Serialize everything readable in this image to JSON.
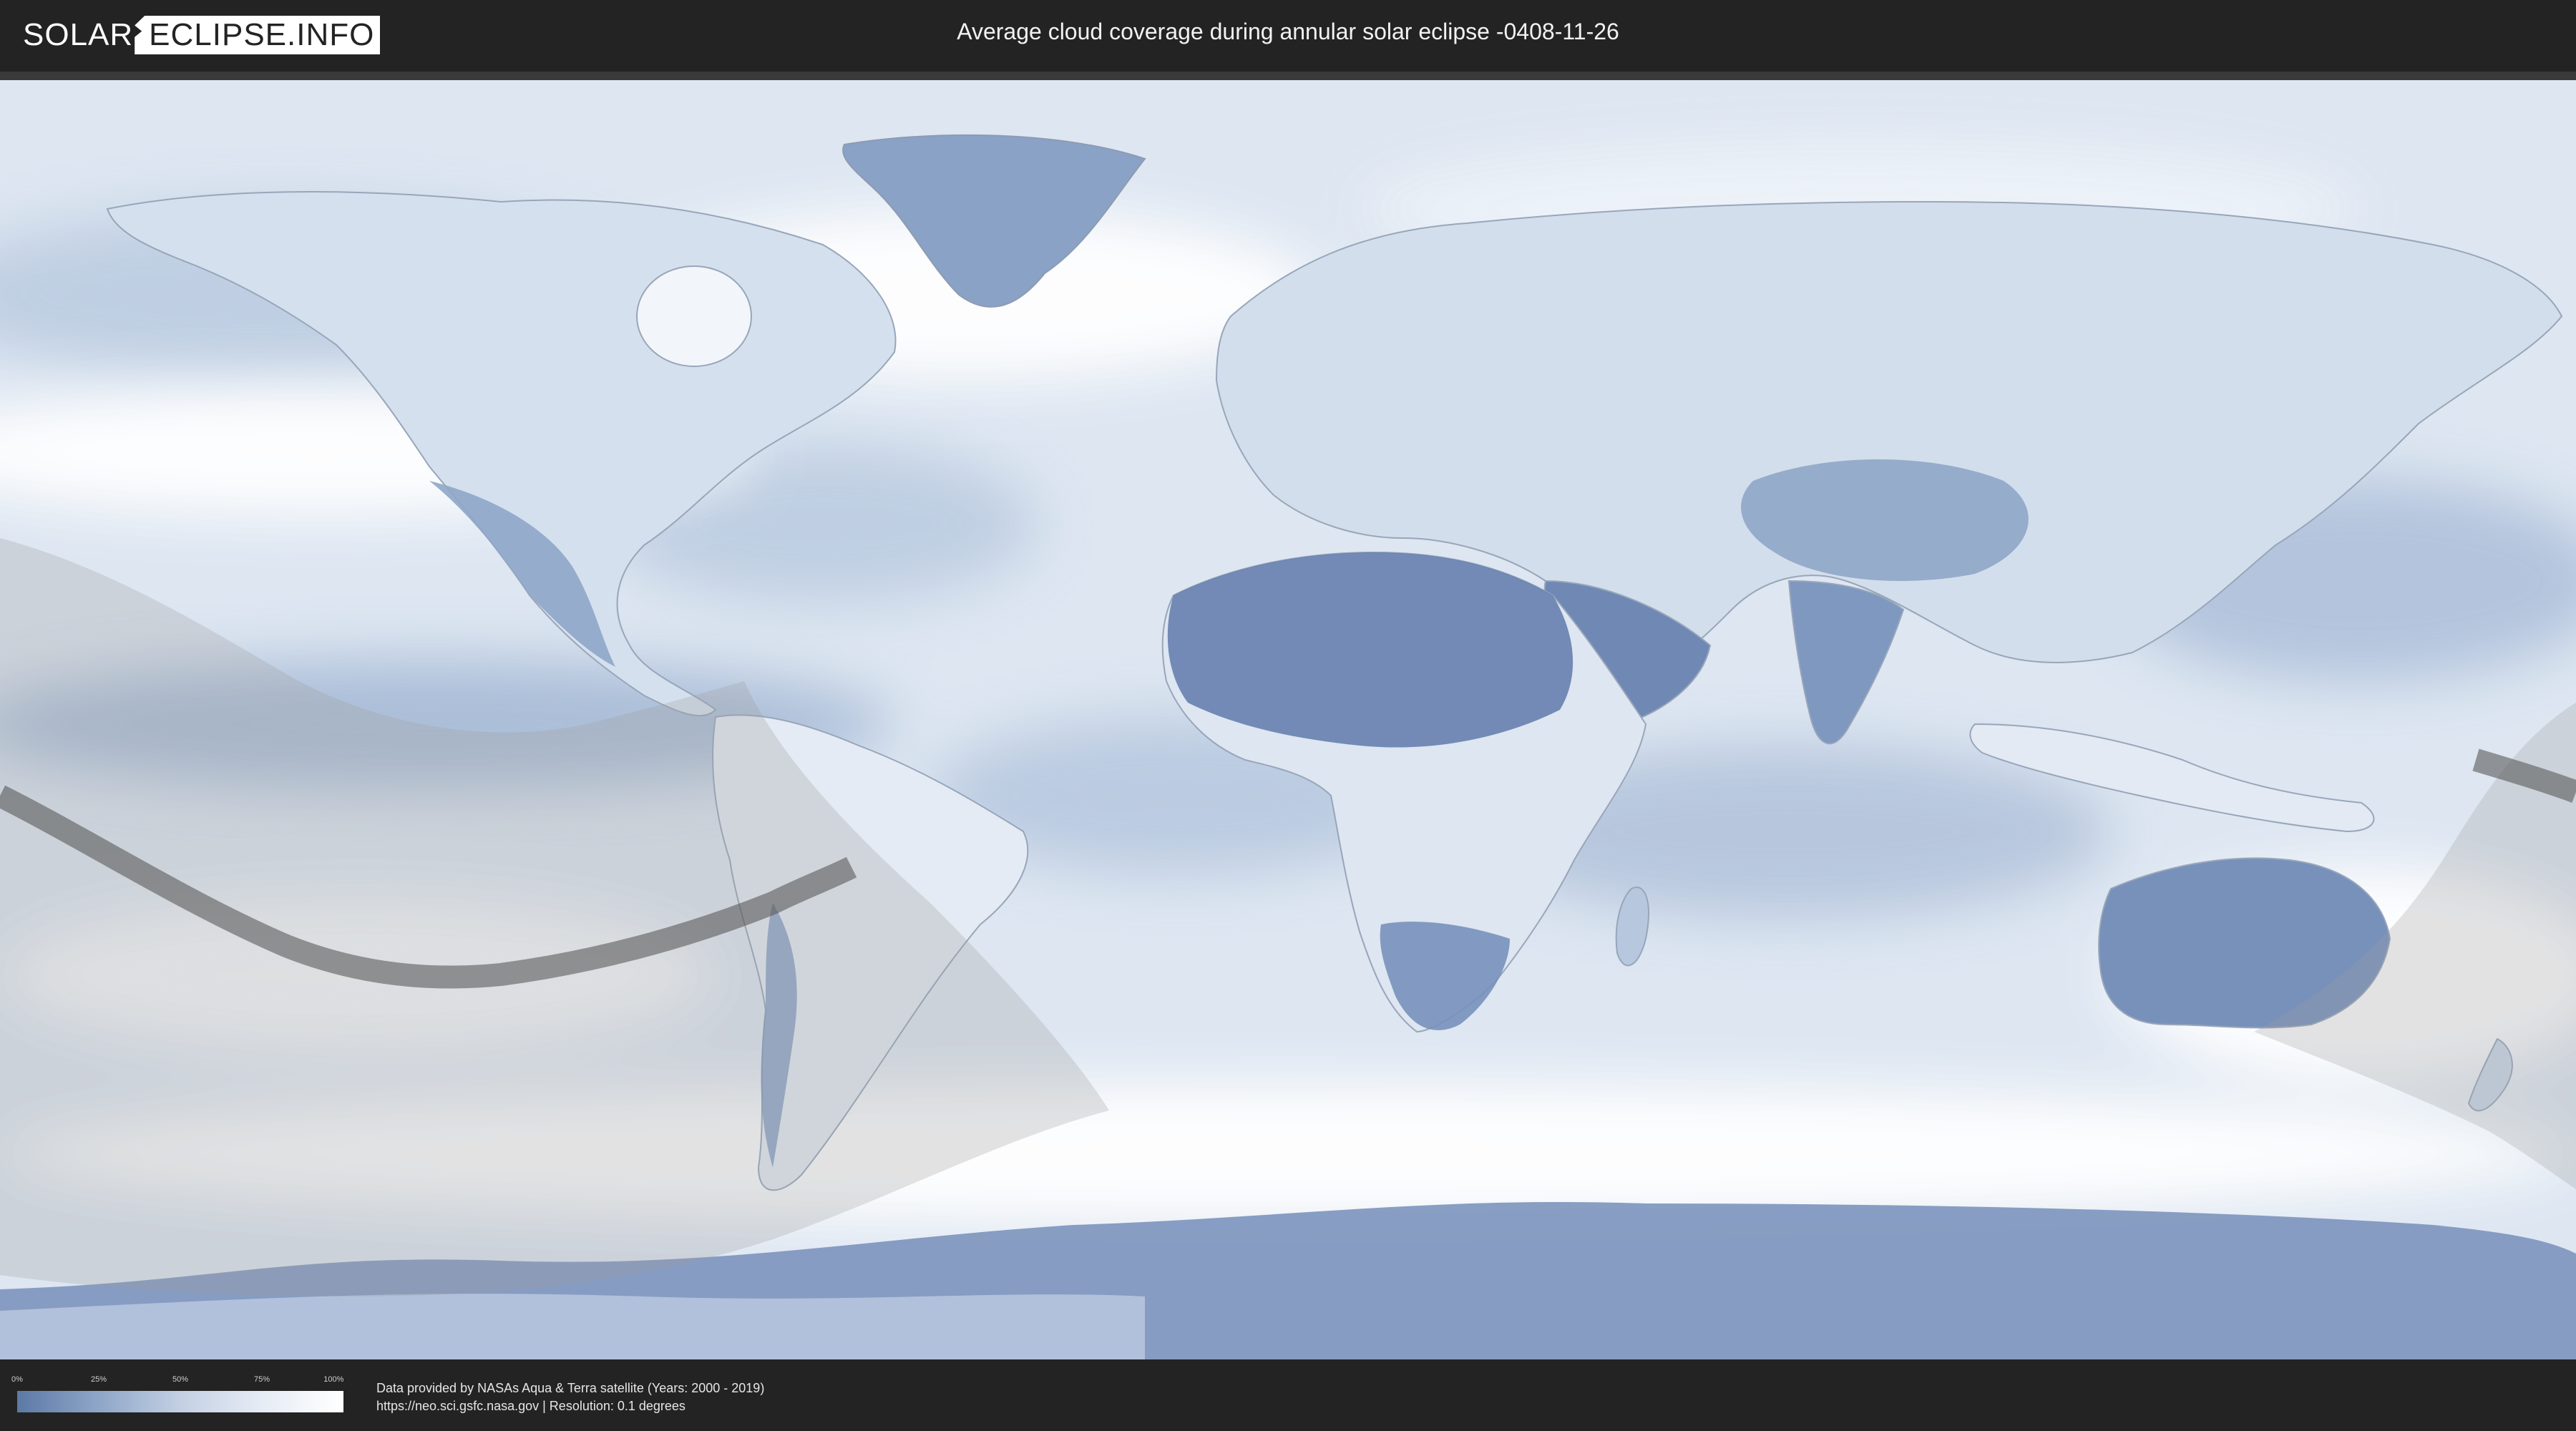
{
  "header": {
    "logo_left": "SOLAR",
    "logo_right": "ECLIPSE.INFO",
    "title": "Average cloud coverage during annular solar eclipse -0408-11-26"
  },
  "legend": {
    "ticks": [
      "0%",
      "25%",
      "50%",
      "75%",
      "100%"
    ],
    "colors": [
      "#5c79a6",
      "#8ea6c8",
      "#c3d0e3",
      "#e6ecf5",
      "#ffffff"
    ]
  },
  "footer": {
    "line1": "Data provided by NASAs Aqua & Terra satellite (Years: 2000 - 2019)",
    "line2": "https://neo.sci.gsfc.nasa.gov | Resolution: 0.1 degrees"
  },
  "map": {
    "ocean_color": "#dbe4ef",
    "cloud_color": "#ffffff",
    "land_clear_color": "#6d87b3",
    "eclipse_shadow_color": "#9e9e9e",
    "central_path_color": "#5a5a5a"
  }
}
